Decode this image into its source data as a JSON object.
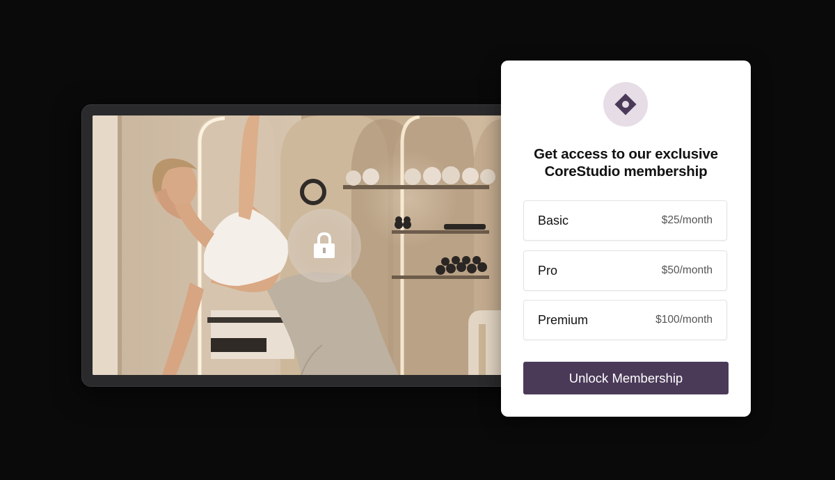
{
  "colors": {
    "page_background": "#0b0a0a",
    "panel_background": "#ffffff",
    "badge_background": "#e6dde6",
    "brand_accent": "#4a3a58",
    "button_text": "#ffffff"
  },
  "video": {
    "locked": true,
    "lock_icon": "lock-icon",
    "scene": "pilates-studio-side-stretch"
  },
  "membership": {
    "logo_icon": "diamond-dot-icon",
    "title_line1": "Get access to our exclusive",
    "title_line2": "CoreStudio membership",
    "plans": [
      {
        "name": "Basic",
        "price": "$25/month"
      },
      {
        "name": "Pro",
        "price": "$50/month"
      },
      {
        "name": "Premium",
        "price": "$100/month"
      }
    ],
    "cta_label": "Unlock Membership"
  }
}
